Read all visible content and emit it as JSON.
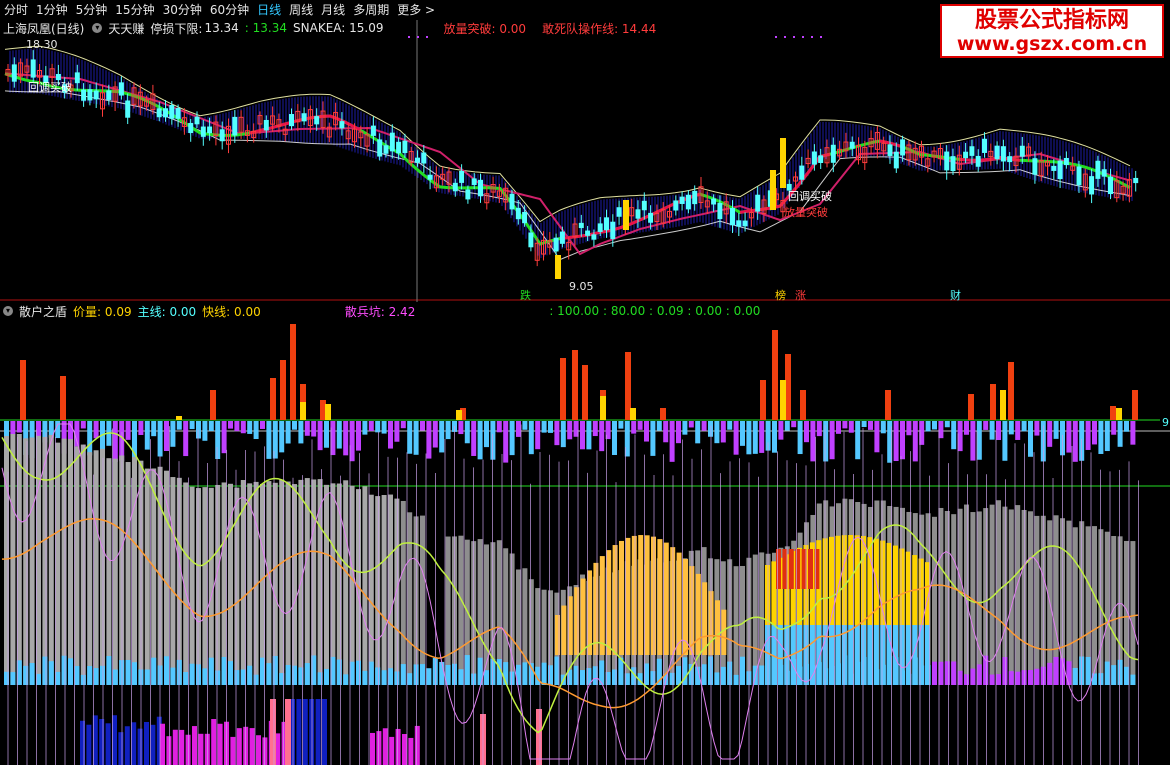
{
  "toolbar": {
    "periods": [
      "分时",
      "1分钟",
      "5分钟",
      "15分钟",
      "30分钟",
      "60分钟",
      "日线",
      "周线",
      "月线",
      "多周期",
      "更多 >"
    ],
    "active_period": "日线"
  },
  "logo": {
    "line1": "股票公式指标网",
    "line2": "www.gszx.com.cn"
  },
  "main_panel": {
    "security": "上海凤凰(日线)",
    "indicator": "天天赚",
    "stop_label": "停损下限:",
    "stop_value": "13.34",
    "stop_value2": ": 13.34",
    "snake_label": "SNAKEA: 15.09",
    "vol_break": "放量突破: 0.00",
    "squad_line": "敢死队操作线: 14.44",
    "high_price": "18.30",
    "low_price": "9.05",
    "ann_pullback1": "回调买破",
    "ann_pullback2": "回调买破",
    "ann_volbreak": "放量突破",
    "tag_drop": "跌",
    "tag_rank": "榜",
    "tag_rise": "涨",
    "tag_fin": "财",
    "colors": {
      "up": "#ff3c3c",
      "down": "#54ffff",
      "ma_green": "#22dd22",
      "ma_red": "#e8104a",
      "ma_pink": "#d0206a",
      "band": "#2020c0"
    }
  },
  "sub_panel": {
    "name": "散户之盾",
    "price_vol": "价量: 0.09",
    "main_line": "主线: 0.00",
    "fast_line": "快线: 0.00",
    "retail_pit": "散兵坑: 2.42",
    "extra_values": ": 100.00 : 80.00 : 0.09 : 0.00 : 0.00",
    "right_axis": "9"
  }
}
